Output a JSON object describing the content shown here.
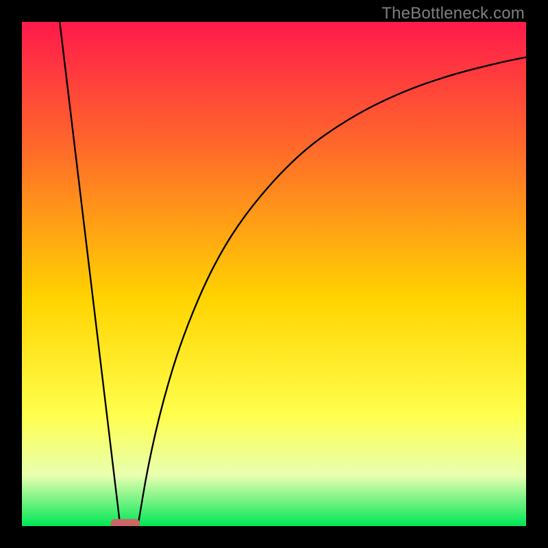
{
  "watermark": "TheBottleneck.com",
  "chart_data": {
    "type": "line",
    "title": "",
    "xlabel": "",
    "ylabel": "",
    "xlim": [
      0,
      100
    ],
    "ylim": [
      0,
      100
    ],
    "gradient_stops": [
      {
        "offset": 0,
        "color": "#ff1a4b"
      },
      {
        "offset": 25,
        "color": "#ff6a2a"
      },
      {
        "offset": 55,
        "color": "#ffd400"
      },
      {
        "offset": 78,
        "color": "#ffff4d"
      },
      {
        "offset": 90,
        "color": "#e8ffb0"
      },
      {
        "offset": 100,
        "color": "#00e756"
      }
    ],
    "series": [
      {
        "name": "left-line",
        "x": [
          7.5,
          19.5
        ],
        "y": [
          100,
          0
        ]
      },
      {
        "name": "right-curve",
        "x": [
          23,
          25,
          28,
          32,
          38,
          45,
          55,
          65,
          75,
          85,
          95,
          100
        ],
        "y": [
          0,
          12,
          25,
          38,
          52,
          63,
          74,
          81,
          86,
          89.5,
          92,
          93
        ]
      }
    ],
    "annotations": [
      {
        "name": "marker",
        "shape": "rounded-rect",
        "x": 20.5,
        "y": 0.5,
        "width_pct": 5.8,
        "height_pct": 1.8,
        "color": "#cc6666"
      }
    ]
  }
}
